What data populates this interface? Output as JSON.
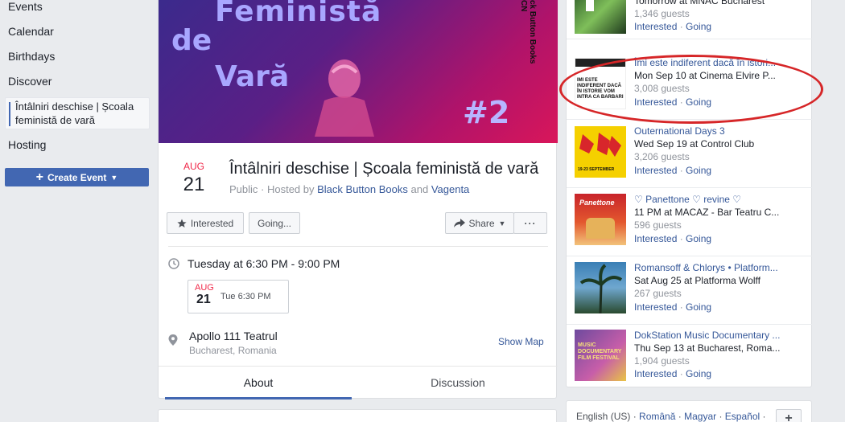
{
  "sidebar": {
    "items": [
      {
        "label": "Events"
      },
      {
        "label": "Calendar"
      },
      {
        "label": "Birthdays"
      },
      {
        "label": "Discover"
      },
      {
        "label": "Întâlniri deschise | Școala feministă de vară"
      },
      {
        "label": "Hosting"
      }
    ],
    "create_label": "Create Event"
  },
  "cover": {
    "line1": "Feministă",
    "line2": "de",
    "line3": "Vară",
    "number": "#2",
    "side_text": "ck Button Books CN"
  },
  "event": {
    "month": "AUG",
    "day": "21",
    "title": "Întâlniri deschise | Școala feministă de vară",
    "privacy": "Public · Hosted by",
    "host1": "Black Button Books",
    "and": "and",
    "host2": "Vagenta",
    "time": "Tuesday at 6:30 PM - 9:00 PM",
    "cal_month": "AUG",
    "cal_day": "21",
    "cal_time": "Tue 6:30 PM",
    "location_name": "Apollo 111 Teatrul",
    "location_sub": "Bucharest, Romania",
    "show_map": "Show Map"
  },
  "actions": {
    "interested": "Interested",
    "going": "Going...",
    "share": "Share",
    "more": "···"
  },
  "tabs": {
    "about": "About",
    "discussion": "Discussion"
  },
  "suggestions": [
    {
      "title": "Tomorrow at MNAC Bucharest",
      "time": "",
      "guests": "1,346 guests",
      "interested": "Interested",
      "going": "Going"
    },
    {
      "title": "Îmi este indiferent dacă în istori...",
      "time": "Mon Sep 10 at Cinema Elvire P...",
      "guests": "3,008 guests",
      "interested": "Interested",
      "going": "Going"
    },
    {
      "title": "Outernational Days 3",
      "time": "Wed Sep 19 at Control Club",
      "guests": "3,206 guests",
      "interested": "Interested",
      "going": "Going"
    },
    {
      "title": "♡ Panettone ♡ revine ♡",
      "time": "11 PM at MACAZ - Bar Teatru C...",
      "guests": "596 guests",
      "interested": "Interested",
      "going": "Going"
    },
    {
      "title": "Romansoff & Chlorys • Platform...",
      "time": "Sat Aug 25 at Platforma Wolff",
      "guests": "267 guests",
      "interested": "Interested",
      "going": "Going"
    },
    {
      "title": "DokStation Music Documentary ...",
      "time": "Thu Sep 13 at Bucharest, Roma...",
      "guests": "1,904 guests",
      "interested": "Interested",
      "going": "Going"
    }
  ],
  "thumb_text": {
    "s2": "IMI ESTE INDIFERENT DACĂ ÎN ISTORIE VOM INTRA CA BARBARI",
    "s3": "19-23 SEPTEMBER",
    "s4": "Panettone",
    "s6": "MUSIC DOCUMENTARY FILM FESTIVAL"
  },
  "languages": {
    "current": "English (US)",
    "sep": "·",
    "l1": "Română",
    "l2": "Magyar",
    "l3": "Español",
    "plus": "+"
  },
  "colors": {
    "accent": "#4267b2",
    "link": "#365899",
    "date_red": "#f02849",
    "annotation": "#d62628"
  }
}
